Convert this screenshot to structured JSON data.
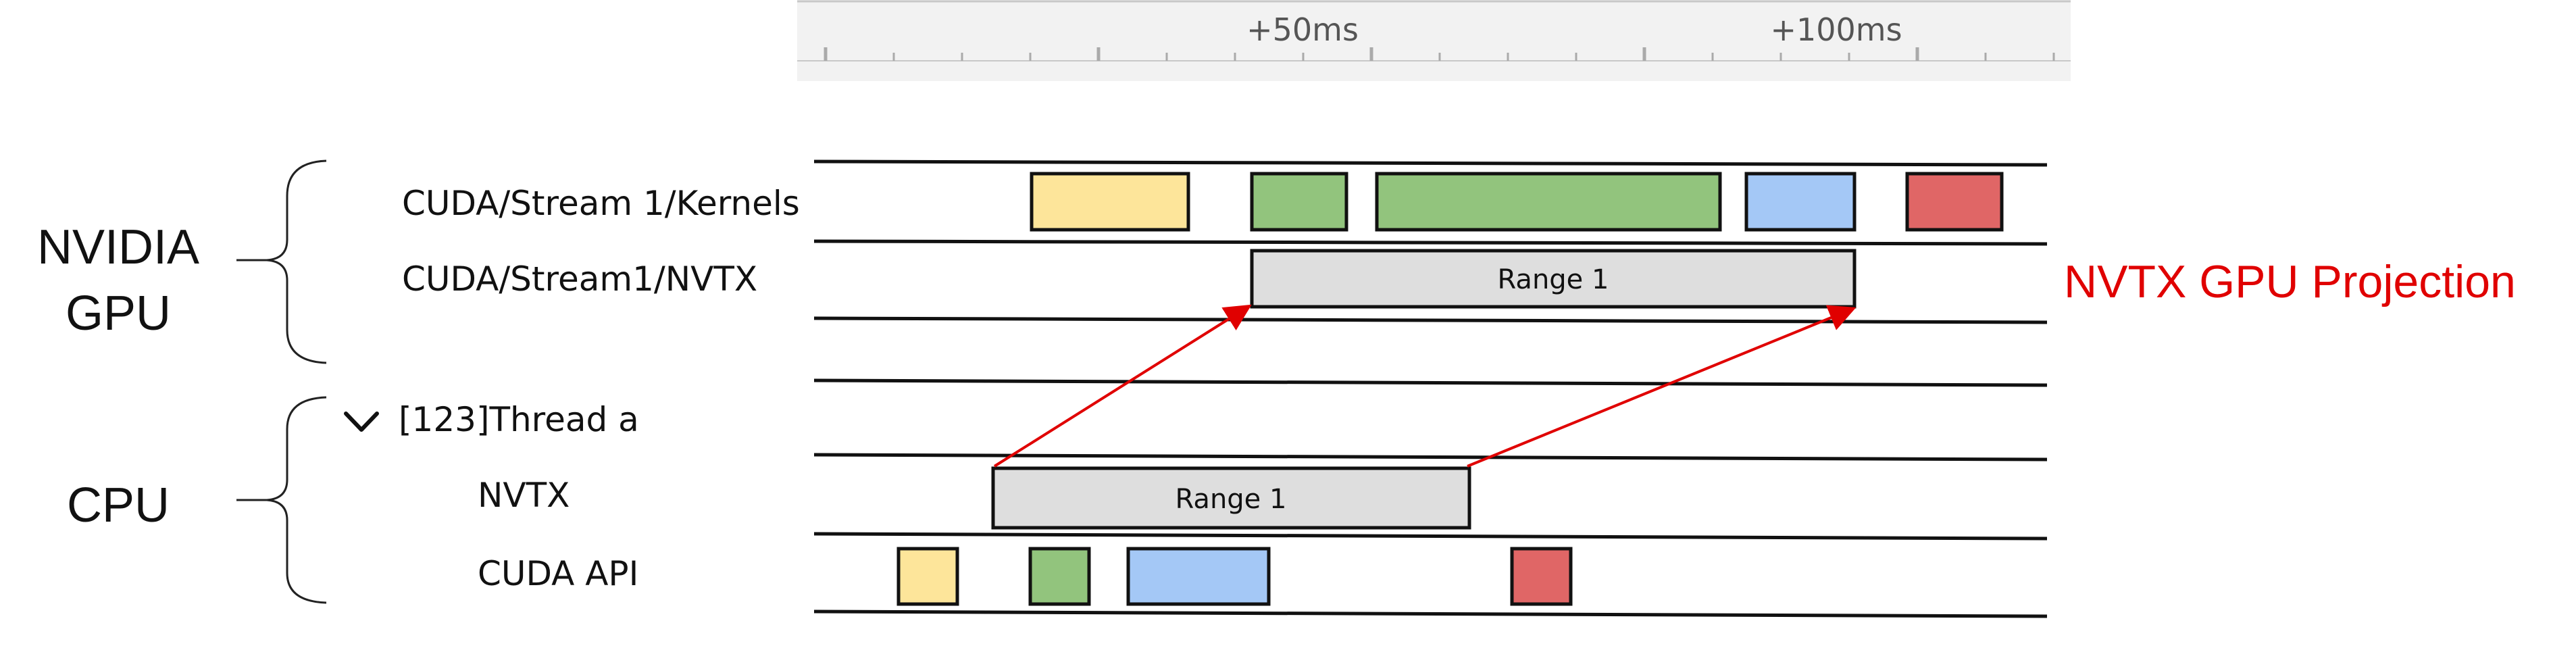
{
  "ruler": {
    "ticks": [
      "+50ms",
      "+100ms"
    ]
  },
  "groups": {
    "gpu_line1": "NVIDIA",
    "gpu_line2": "GPU",
    "cpu": "CPU"
  },
  "rows": {
    "kernels": "CUDA/Stream 1/Kernels",
    "gpu_nvtx": "CUDA/Stream1/NVTX",
    "thread": "[123]Thread a",
    "cpu_nvtx": "NVTX",
    "cuda_api": "CUDA API"
  },
  "ranges": {
    "gpu_range": "Range 1",
    "cpu_range": "Range 1"
  },
  "annotation": {
    "projection": "NVTX GPU Projection",
    "color": "#e00000"
  },
  "colors": {
    "yellow": "#fde59a",
    "green": "#92c47d",
    "blue": "#a4c8f6",
    "red": "#e06666",
    "range_fill": "#dedede"
  }
}
